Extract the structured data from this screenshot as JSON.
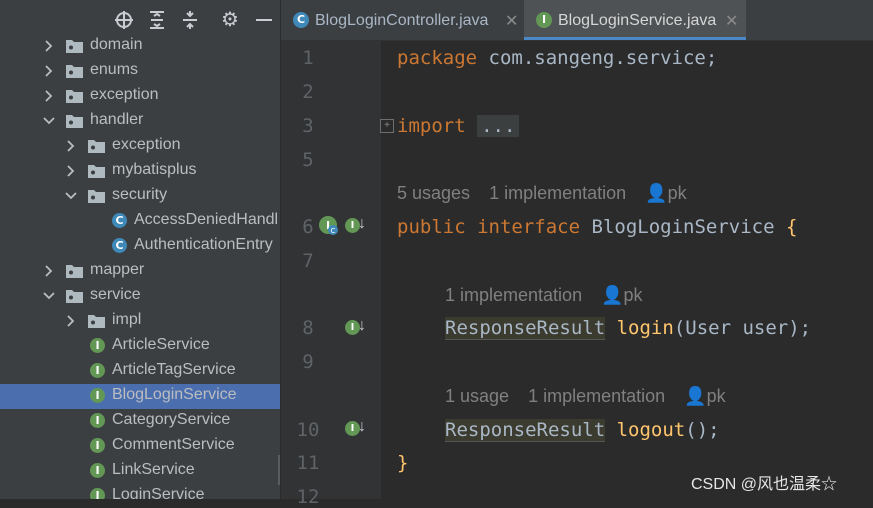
{
  "toolbar": {
    "icons": [
      "target-icon",
      "expand-all-icon",
      "collapse-all-icon",
      "gear-icon",
      "minimize-icon"
    ]
  },
  "tree": [
    {
      "label": "domain",
      "type": "folder",
      "arrow": "right",
      "indent": 0
    },
    {
      "label": "enums",
      "type": "folder",
      "arrow": "right",
      "indent": 0
    },
    {
      "label": "exception",
      "type": "folder",
      "arrow": "right",
      "indent": 0
    },
    {
      "label": "handler",
      "type": "folder",
      "arrow": "down",
      "indent": 0
    },
    {
      "label": "exception",
      "type": "folder",
      "arrow": "right",
      "indent": 1
    },
    {
      "label": "mybatisplus",
      "type": "folder",
      "arrow": "right",
      "indent": 1
    },
    {
      "label": "security",
      "type": "folder",
      "arrow": "down",
      "indent": 1
    },
    {
      "label": "AccessDeniedHandl",
      "type": "class",
      "indent": 2
    },
    {
      "label": "AuthenticationEntry",
      "type": "class",
      "indent": 2
    },
    {
      "label": "mapper",
      "type": "folder",
      "arrow": "right",
      "indent": 0
    },
    {
      "label": "service",
      "type": "folder",
      "arrow": "down",
      "indent": 0
    },
    {
      "label": "impl",
      "type": "folder",
      "arrow": "right",
      "indent": 1
    },
    {
      "label": "ArticleService",
      "type": "interface",
      "indent": 1
    },
    {
      "label": "ArticleTagService",
      "type": "interface",
      "indent": 1
    },
    {
      "label": "BlogLoginService",
      "type": "interface",
      "indent": 1,
      "selected": true
    },
    {
      "label": "CategoryService",
      "type": "interface",
      "indent": 1
    },
    {
      "label": "CommentService",
      "type": "interface",
      "indent": 1
    },
    {
      "label": "LinkService",
      "type": "interface",
      "indent": 1
    },
    {
      "label": "LoginService",
      "type": "interface",
      "indent": 1
    }
  ],
  "tabs": [
    {
      "label": "BlogLoginController.java",
      "icon": "C",
      "active": false
    },
    {
      "label": "BlogLoginService.java",
      "icon": "I",
      "active": true
    }
  ],
  "editor": {
    "line_numbers": [
      "1",
      "2",
      "3",
      "5",
      "6",
      "7",
      "8",
      "9",
      "10",
      "11",
      "12"
    ],
    "package_kw": "package",
    "package_name": "com.sangeng.service;",
    "import_kw": "import",
    "import_fold": "...",
    "hint1": {
      "usages": "5 usages",
      "impl": "1 implementation",
      "author": "pk"
    },
    "decl": {
      "kw1": "public",
      "kw2": "interface",
      "name": "BlogLoginService",
      "brace": "{"
    },
    "hint2": {
      "impl": "1 implementation",
      "author": "pk"
    },
    "m1": {
      "type": "ResponseResult",
      "name": "login",
      "args": "(User user);"
    },
    "hint3": {
      "usages": "1 usage",
      "impl": "1 implementation",
      "author": "pk"
    },
    "m2": {
      "type": "ResponseResult",
      "name": "logout",
      "args": "();"
    },
    "close_brace": "}"
  },
  "watermark": "CSDN @风也温柔☆",
  "colors": {
    "keyword": "#cc7832",
    "function": "#ffc66d",
    "selection": "#4b6eaf",
    "interface_icon": "#629755",
    "class_icon": "#3f89b9"
  }
}
